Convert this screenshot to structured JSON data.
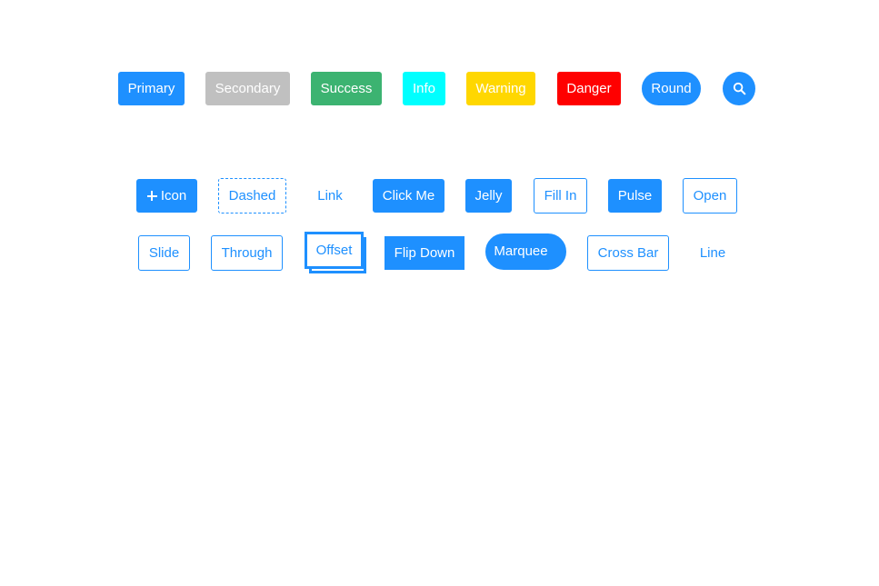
{
  "colors": {
    "primary": "#1e90ff",
    "secondary": "#c0c0c0",
    "success": "#3cb371",
    "info": "#00ffff",
    "warning": "#ffd700",
    "danger": "#ff0000",
    "background": "#ffffff"
  },
  "row1": {
    "primary": "Primary",
    "secondary": "Secondary",
    "success": "Success",
    "info": "Info",
    "warning": "Warning",
    "danger": "Danger",
    "round": "Round",
    "search_icon": "search-icon"
  },
  "row2": {
    "icon_label": "Icon",
    "plus_icon": "plus-icon",
    "dashed": "Dashed",
    "link": "Link",
    "click_me": "Click Me",
    "jelly": "Jelly",
    "fill_in": "Fill In",
    "pulse": "Pulse",
    "open": "Open"
  },
  "row3": {
    "slide": "Slide",
    "through": "Through",
    "offset": "Offset",
    "flip_down": "Flip Down",
    "marquee": "Marquee",
    "cross_bar": "Cross Bar",
    "line": "Line"
  }
}
